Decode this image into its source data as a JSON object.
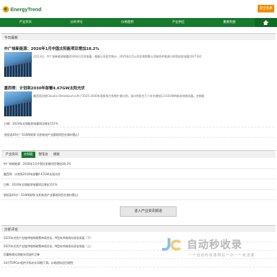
{
  "header": {
    "logo_text": "EnergyTrend",
    "lang_button": "获全资源"
  },
  "nav": {
    "items": [
      "产业资讯",
      "分析评论",
      "价格趋势",
      "产业供应",
      "重要热搜"
    ]
  },
  "today": {
    "title": "今日最新",
    "features": [
      {
        "title": "中广核新能源：2026年1月中国太阳能项目增加18.2%",
        "desc": "2月13日，中广核新能源披露2026年1月发电量。根据公司初步统计，2025年1月公司及其附属公司按合并报表口径完成发电量1027.6亿"
      },
      {
        "title": "墨西哥：计划到2030年部署4.67GW太阳光伏",
        "desc": "墨西哥总统Claudia Sheinbaum公布了2025-2030年国家电力系统扩建计划，该计划旨在于六年内增加13.02GW的新发电装机量。在新能"
      }
    ],
    "lines": [
      "日南：2024年太阳能发电量同比增长151%",
      "农投县40亿！5GW网状矿太阳电池产业基地项目在湖州落山！"
    ]
  },
  "tabs": {
    "items": [
      "产业资讯",
      "太阳能",
      "锂电池",
      "储能"
    ],
    "active": 1,
    "list": [
      "中广核新能源：2026年1月中国太阳能项目增加18.2%",
      "墨西哥：计划到2030年部署4.67GW太阳光伏",
      "日南：2024年太阳能发电量同比增长151%",
      "农投县40亿！5GW网状矿太阳电池产业基地项目在湖州落山！"
    ]
  },
  "more_button": "进入产业资讯频道",
  "analysis": {
    "title": "分析评论",
    "items": [
      "2025年光伏产业链供给侧政策持续优化，N型技术继续向深化发展（下）",
      "2025年光伏产业链供给侧政策持续优化，N型技术继续向深化发展（上）",
      "匹赢新增太阳能光伏组件之锋",
      "10月TOPCon组件开标价价续格下滑，价格逐标回归理性"
    ]
  },
  "watermark": {
    "text": "自动秒收录",
    "sub": "一个自动秒收录网站一次一一有流量"
  }
}
